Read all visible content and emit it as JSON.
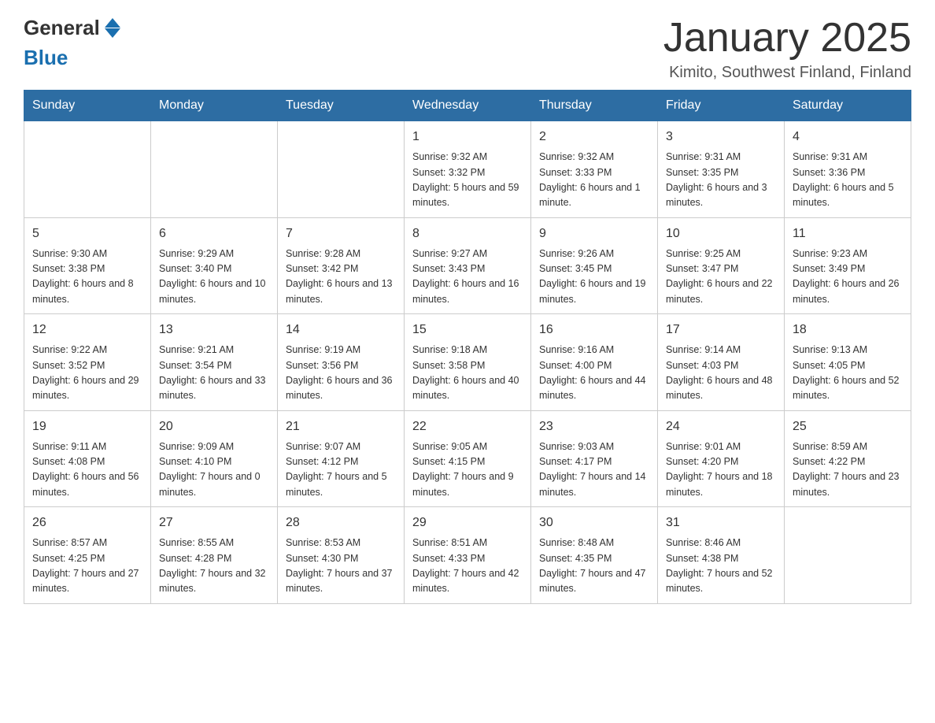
{
  "logo": {
    "text_general": "General",
    "text_blue": "Blue"
  },
  "title": "January 2025",
  "subtitle": "Kimito, Southwest Finland, Finland",
  "days_header": [
    "Sunday",
    "Monday",
    "Tuesday",
    "Wednesday",
    "Thursday",
    "Friday",
    "Saturday"
  ],
  "weeks": [
    [
      {
        "day": "",
        "info": ""
      },
      {
        "day": "",
        "info": ""
      },
      {
        "day": "",
        "info": ""
      },
      {
        "day": "1",
        "info": "Sunrise: 9:32 AM\nSunset: 3:32 PM\nDaylight: 5 hours\nand 59 minutes."
      },
      {
        "day": "2",
        "info": "Sunrise: 9:32 AM\nSunset: 3:33 PM\nDaylight: 6 hours\nand 1 minute."
      },
      {
        "day": "3",
        "info": "Sunrise: 9:31 AM\nSunset: 3:35 PM\nDaylight: 6 hours\nand 3 minutes."
      },
      {
        "day": "4",
        "info": "Sunrise: 9:31 AM\nSunset: 3:36 PM\nDaylight: 6 hours\nand 5 minutes."
      }
    ],
    [
      {
        "day": "5",
        "info": "Sunrise: 9:30 AM\nSunset: 3:38 PM\nDaylight: 6 hours\nand 8 minutes."
      },
      {
        "day": "6",
        "info": "Sunrise: 9:29 AM\nSunset: 3:40 PM\nDaylight: 6 hours\nand 10 minutes."
      },
      {
        "day": "7",
        "info": "Sunrise: 9:28 AM\nSunset: 3:42 PM\nDaylight: 6 hours\nand 13 minutes."
      },
      {
        "day": "8",
        "info": "Sunrise: 9:27 AM\nSunset: 3:43 PM\nDaylight: 6 hours\nand 16 minutes."
      },
      {
        "day": "9",
        "info": "Sunrise: 9:26 AM\nSunset: 3:45 PM\nDaylight: 6 hours\nand 19 minutes."
      },
      {
        "day": "10",
        "info": "Sunrise: 9:25 AM\nSunset: 3:47 PM\nDaylight: 6 hours\nand 22 minutes."
      },
      {
        "day": "11",
        "info": "Sunrise: 9:23 AM\nSunset: 3:49 PM\nDaylight: 6 hours\nand 26 minutes."
      }
    ],
    [
      {
        "day": "12",
        "info": "Sunrise: 9:22 AM\nSunset: 3:52 PM\nDaylight: 6 hours\nand 29 minutes."
      },
      {
        "day": "13",
        "info": "Sunrise: 9:21 AM\nSunset: 3:54 PM\nDaylight: 6 hours\nand 33 minutes."
      },
      {
        "day": "14",
        "info": "Sunrise: 9:19 AM\nSunset: 3:56 PM\nDaylight: 6 hours\nand 36 minutes."
      },
      {
        "day": "15",
        "info": "Sunrise: 9:18 AM\nSunset: 3:58 PM\nDaylight: 6 hours\nand 40 minutes."
      },
      {
        "day": "16",
        "info": "Sunrise: 9:16 AM\nSunset: 4:00 PM\nDaylight: 6 hours\nand 44 minutes."
      },
      {
        "day": "17",
        "info": "Sunrise: 9:14 AM\nSunset: 4:03 PM\nDaylight: 6 hours\nand 48 minutes."
      },
      {
        "day": "18",
        "info": "Sunrise: 9:13 AM\nSunset: 4:05 PM\nDaylight: 6 hours\nand 52 minutes."
      }
    ],
    [
      {
        "day": "19",
        "info": "Sunrise: 9:11 AM\nSunset: 4:08 PM\nDaylight: 6 hours\nand 56 minutes."
      },
      {
        "day": "20",
        "info": "Sunrise: 9:09 AM\nSunset: 4:10 PM\nDaylight: 7 hours\nand 0 minutes."
      },
      {
        "day": "21",
        "info": "Sunrise: 9:07 AM\nSunset: 4:12 PM\nDaylight: 7 hours\nand 5 minutes."
      },
      {
        "day": "22",
        "info": "Sunrise: 9:05 AM\nSunset: 4:15 PM\nDaylight: 7 hours\nand 9 minutes."
      },
      {
        "day": "23",
        "info": "Sunrise: 9:03 AM\nSunset: 4:17 PM\nDaylight: 7 hours\nand 14 minutes."
      },
      {
        "day": "24",
        "info": "Sunrise: 9:01 AM\nSunset: 4:20 PM\nDaylight: 7 hours\nand 18 minutes."
      },
      {
        "day": "25",
        "info": "Sunrise: 8:59 AM\nSunset: 4:22 PM\nDaylight: 7 hours\nand 23 minutes."
      }
    ],
    [
      {
        "day": "26",
        "info": "Sunrise: 8:57 AM\nSunset: 4:25 PM\nDaylight: 7 hours\nand 27 minutes."
      },
      {
        "day": "27",
        "info": "Sunrise: 8:55 AM\nSunset: 4:28 PM\nDaylight: 7 hours\nand 32 minutes."
      },
      {
        "day": "28",
        "info": "Sunrise: 8:53 AM\nSunset: 4:30 PM\nDaylight: 7 hours\nand 37 minutes."
      },
      {
        "day": "29",
        "info": "Sunrise: 8:51 AM\nSunset: 4:33 PM\nDaylight: 7 hours\nand 42 minutes."
      },
      {
        "day": "30",
        "info": "Sunrise: 8:48 AM\nSunset: 4:35 PM\nDaylight: 7 hours\nand 47 minutes."
      },
      {
        "day": "31",
        "info": "Sunrise: 8:46 AM\nSunset: 4:38 PM\nDaylight: 7 hours\nand 52 minutes."
      },
      {
        "day": "",
        "info": ""
      }
    ]
  ]
}
